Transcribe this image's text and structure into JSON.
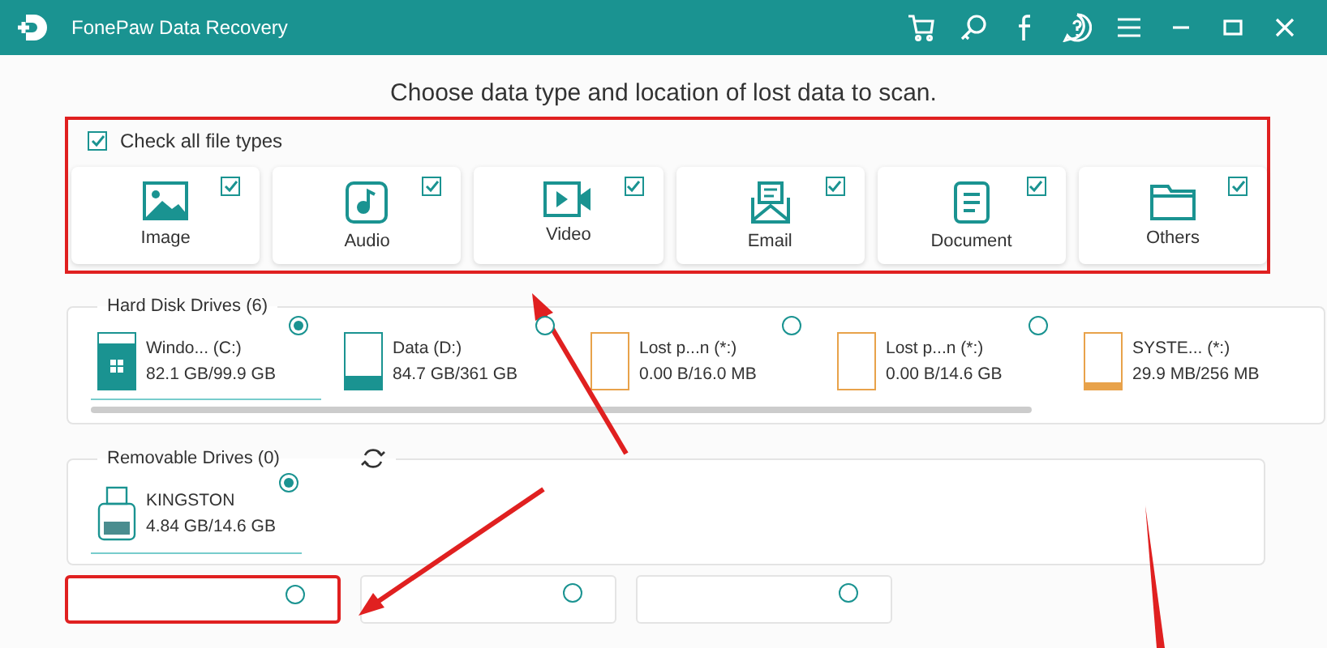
{
  "window": {
    "title": "FonePaw Data Recovery"
  },
  "heading": "Choose data type and location of lost data to scan.",
  "file_types": {
    "check_all": {
      "label": "Check all file types",
      "checked": true
    },
    "items": [
      {
        "kind": "image",
        "label": "Image",
        "checked": true
      },
      {
        "kind": "audio",
        "label": "Audio",
        "checked": true
      },
      {
        "kind": "video",
        "label": "Video",
        "checked": true
      },
      {
        "kind": "email",
        "label": "Email",
        "checked": true
      },
      {
        "kind": "document",
        "label": "Document",
        "checked": true
      },
      {
        "kind": "others",
        "label": "Others",
        "checked": true
      }
    ]
  },
  "hard_disk_drives": {
    "title": "Hard Disk Drives (6)",
    "drives": [
      {
        "kind": "windows",
        "name": "Windo... (C:)",
        "size": "82.1 GB/99.9 GB",
        "level": 0.82,
        "selected": true
      },
      {
        "kind": "volume",
        "name": "Data (D:)",
        "size": "84.7 GB/361 GB",
        "level": 0.23,
        "selected": false
      },
      {
        "kind": "lost",
        "name": "Lost p...n (*:)",
        "size": "0.00  B/16.0 MB",
        "selected": false
      },
      {
        "kind": "lost",
        "name": "Lost p...n (*:)",
        "size": "0.00  B/14.6 GB",
        "selected": false
      },
      {
        "kind": "system",
        "name": "SYSTE... (*:)",
        "size": "29.9 MB/256 MB",
        "level": 0.12
      }
    ]
  },
  "removable_drives": {
    "title": "Removable Drives (0)",
    "drives": [
      {
        "name": "KINGSTON",
        "size": "4.84 GB/14.6 GB",
        "selected": true
      }
    ]
  },
  "locations": [
    {
      "selected": false
    },
    {
      "selected": false
    },
    {
      "selected": false
    }
  ]
}
